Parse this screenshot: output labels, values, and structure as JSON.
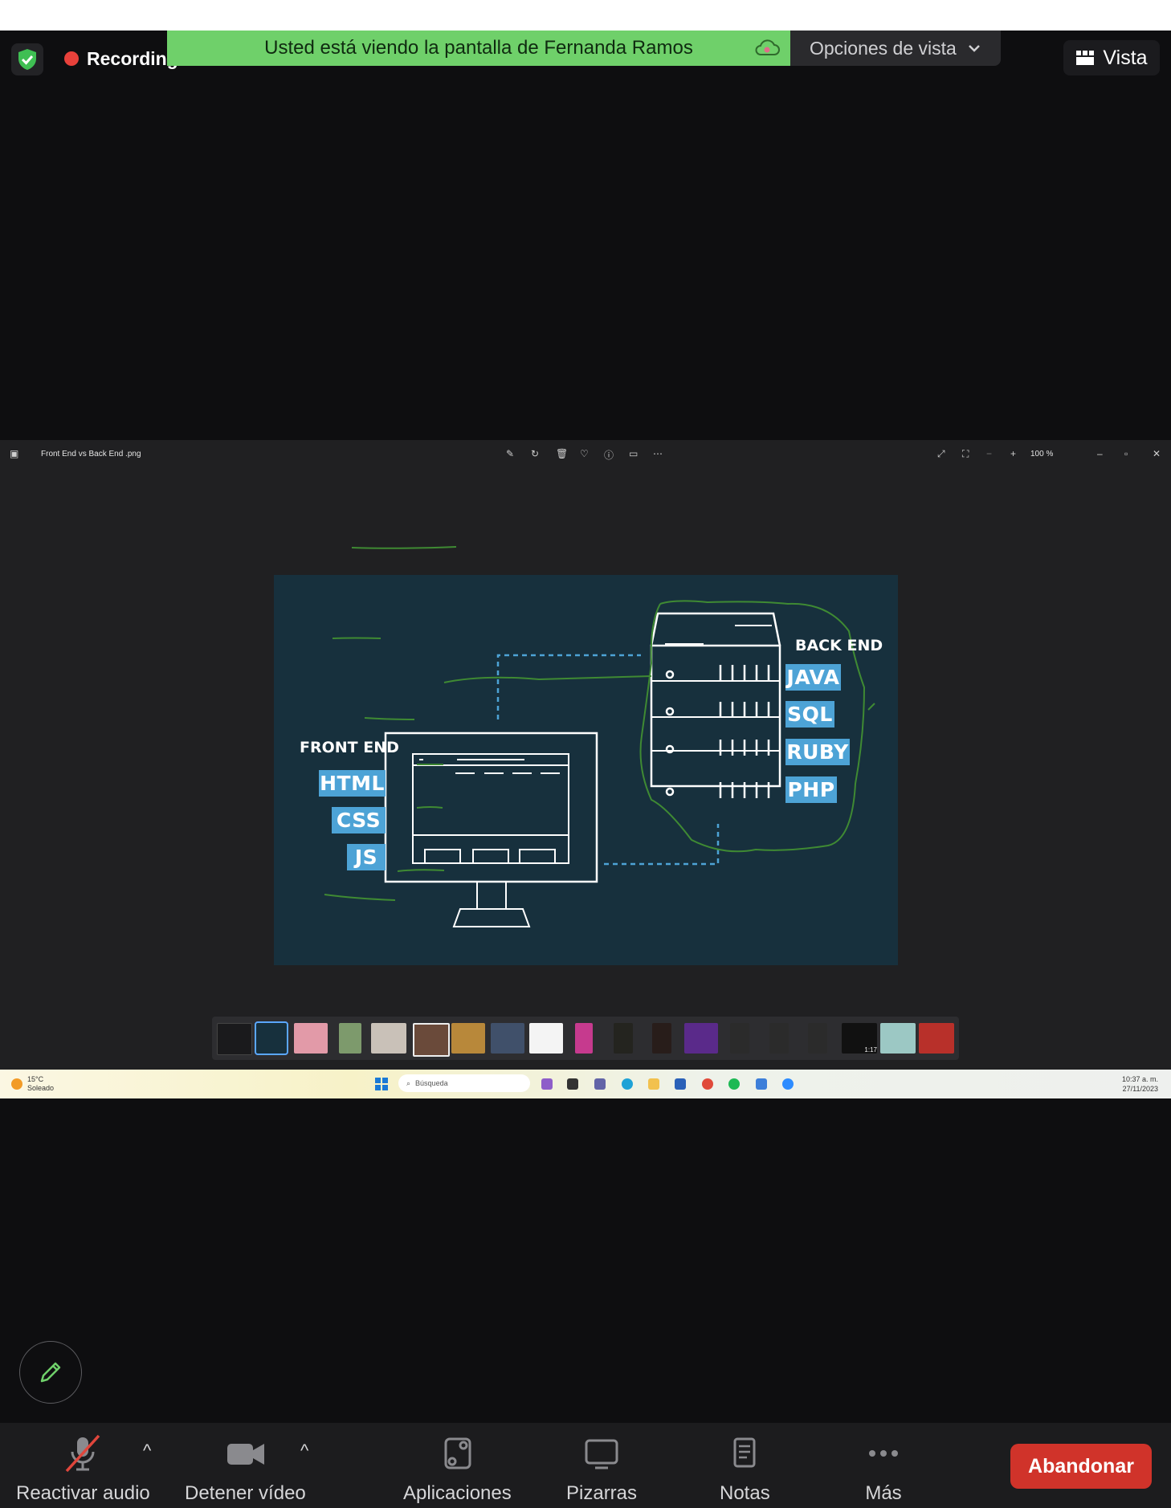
{
  "meeting": {
    "recording_label": "Recording",
    "share_banner": "Usted está viendo la pantalla de Fernanda Ramos",
    "view_options_label": "Opciones de vista",
    "view_label": "Vista"
  },
  "viewer": {
    "file_name": "Front End vs Back End .png",
    "zoom": "100 %"
  },
  "image": {
    "front_heading": "FRONT END",
    "front_tags": [
      "HTML",
      "CSS",
      "JS"
    ],
    "back_heading": "BACK END",
    "back_tags": [
      "JAVA",
      "SQL",
      "RUBY",
      "PHP"
    ],
    "bg_color": "#17303d",
    "tag_color": "#4da3d6",
    "annotation_color": "#3f8a33"
  },
  "filmstrip": {
    "thumb_duration": "1:17"
  },
  "taskbar": {
    "temperature": "15°C",
    "weather": "Soleado",
    "search_placeholder": "Búsqueda",
    "time": "10:37 a. m.",
    "date": "27/11/2023"
  },
  "toolbar": {
    "audio": "Reactivar audio",
    "video": "Detener vídeo",
    "apps": "Aplicaciones",
    "whiteboards": "Pizarras",
    "notes": "Notas",
    "more": "Más",
    "leave": "Abandonar"
  },
  "colors": {
    "banner": "#6fd06a",
    "leave_button": "#d0332a",
    "recording_dot": "#e8413b",
    "shield": "#3fbf53"
  }
}
